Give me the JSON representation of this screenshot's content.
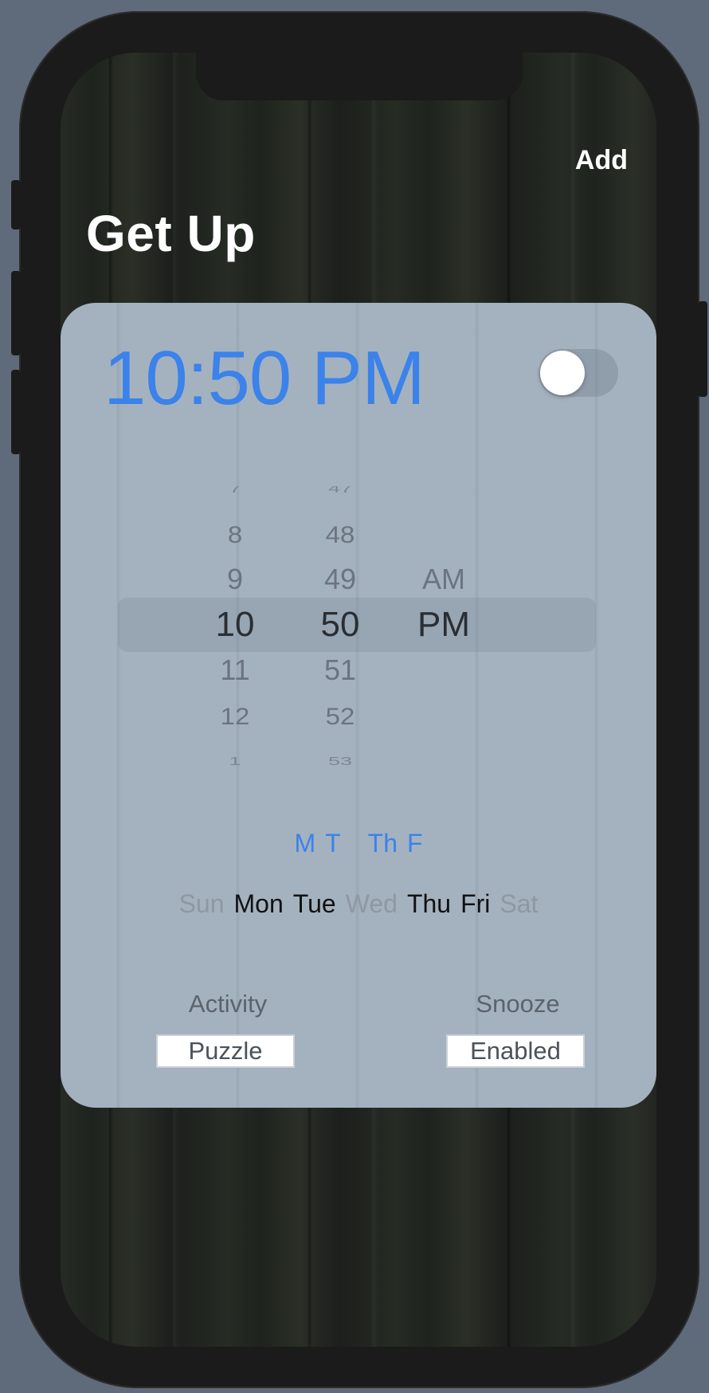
{
  "nav": {
    "title": "Get Up",
    "add_label": "Add"
  },
  "alarm": {
    "time_display": "10:50 PM",
    "enabled": false
  },
  "picker": {
    "hours": [
      "7",
      "8",
      "9",
      "10",
      "11",
      "12",
      "1"
    ],
    "minutes": [
      "47",
      "48",
      "49",
      "50",
      "51",
      "52",
      "53"
    ],
    "periods": [
      "AM",
      "PM"
    ],
    "selected": {
      "hour": "10",
      "minute": "50",
      "period": "PM"
    }
  },
  "repeat_summary": [
    "M",
    "T",
    "Th",
    "F"
  ],
  "days": [
    {
      "label": "Sun",
      "selected": false
    },
    {
      "label": "Mon",
      "selected": true
    },
    {
      "label": "Tue",
      "selected": true
    },
    {
      "label": "Wed",
      "selected": false
    },
    {
      "label": "Thu",
      "selected": true
    },
    {
      "label": "Fri",
      "selected": true
    },
    {
      "label": "Sat",
      "selected": false
    }
  ],
  "options": {
    "activity": {
      "label": "Activity",
      "value": "Puzzle"
    },
    "snooze": {
      "label": "Snooze",
      "value": "Enabled"
    }
  },
  "colors": {
    "accent": "#3b82ea",
    "card_background": "#a4b2bf",
    "day_selected": "#111111",
    "day_unselected": "#8f98a2"
  }
}
